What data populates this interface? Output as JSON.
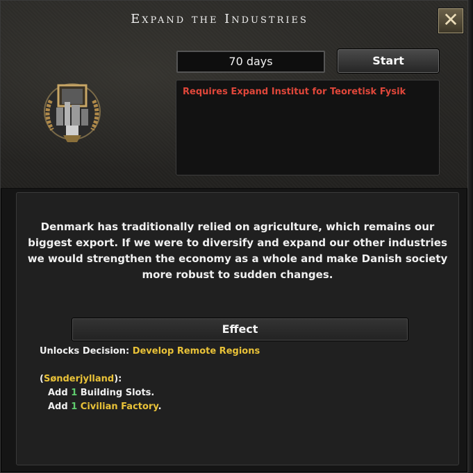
{
  "window": {
    "title": "Expand the Industries",
    "close_symbol": "✕"
  },
  "header": {
    "days": "70 days",
    "start_label": "Start",
    "requirement": "Requires Expand Institut for Teoretisk Fysik"
  },
  "description": [
    "Denmark has traditionally relied on agriculture, which remains our",
    "biggest export. If we were to diversify and expand our other industries",
    "we would strengthen the economy as a whole and make Danish society",
    "more robust to sudden changes."
  ],
  "effect": {
    "header": "Effect",
    "unlocks_prefix": "Unlocks Decision: ",
    "unlocks_value": "Develop Remote Regions",
    "state_open": "(",
    "state_name": "Sønderjylland",
    "state_close": "):",
    "add1_prefix": "Add ",
    "add1_number": "1",
    "add1_text": " Building Slots.",
    "add2_prefix": "Add ",
    "add2_number": "1",
    "add2_target": "Civilian Factory",
    "add2_suffix": "."
  },
  "colors": {
    "requirement": "#e0473a",
    "highlight": "#e9c238",
    "number": "#5fce6e"
  },
  "icons": {
    "emblem": "industry-emblem-icon",
    "close": "close-icon"
  }
}
